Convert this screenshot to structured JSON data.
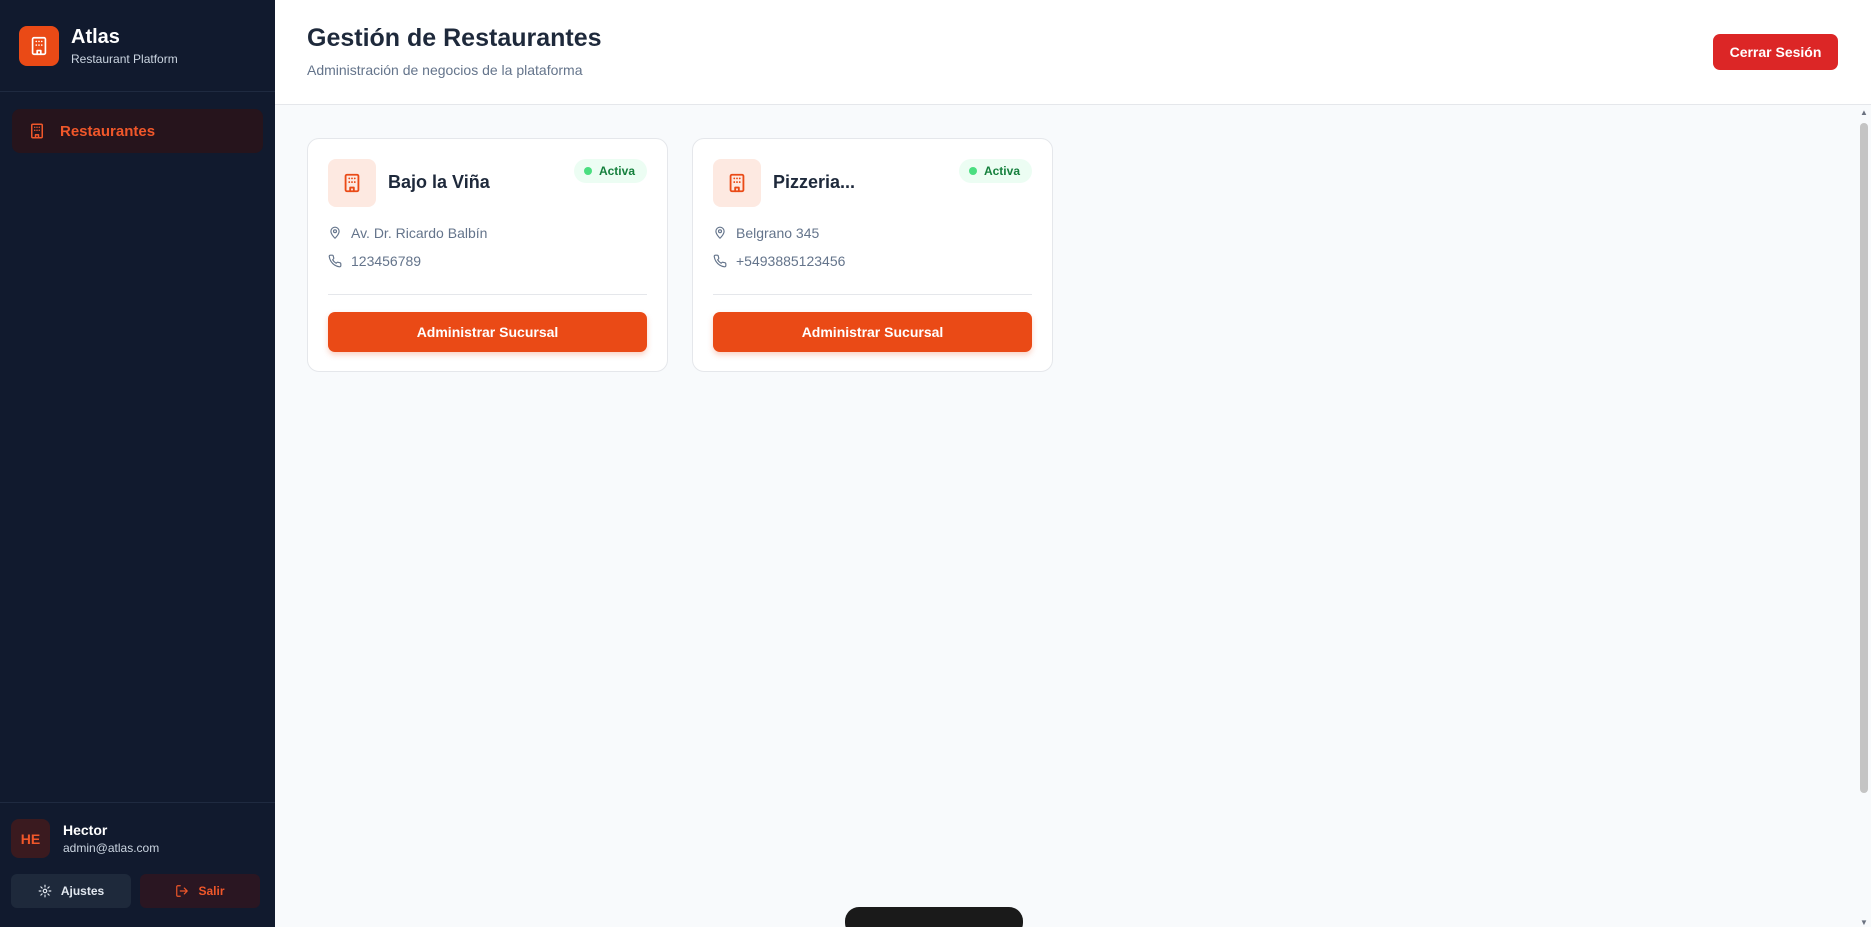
{
  "brand": {
    "name": "Atlas",
    "subtitle": "Restaurant Platform",
    "icon": "building-icon"
  },
  "nav": {
    "items": [
      {
        "label": "Restaurantes",
        "icon": "building-icon",
        "active": true
      }
    ]
  },
  "user": {
    "initials": "HE",
    "name": "Hector",
    "email": "admin@atlas.com"
  },
  "sidebar_actions": {
    "settings_label": "Ajustes",
    "settings_icon": "gear-icon",
    "exit_label": "Salir",
    "exit_icon": "logout-icon"
  },
  "header": {
    "title": "Gestión de Restaurantes",
    "subtitle": "Administración de negocios de la plataforma",
    "logout_label": "Cerrar Sesión"
  },
  "restaurants": [
    {
      "name": "Bajo la Viña",
      "status": "Activa",
      "address": "Av. Dr. Ricardo Balbín",
      "phone": "123456789",
      "action_label": "Administrar Sucursal"
    },
    {
      "name": "Pizzeria...",
      "status": "Activa",
      "address": "Belgrano 345",
      "phone": "+5493885123456",
      "action_label": "Administrar Sucursal"
    }
  ],
  "colors": {
    "accent": "#ea4a16",
    "danger": "#dc2626",
    "sidebar_bg": "#111a2e",
    "status_active": "#15803d"
  }
}
